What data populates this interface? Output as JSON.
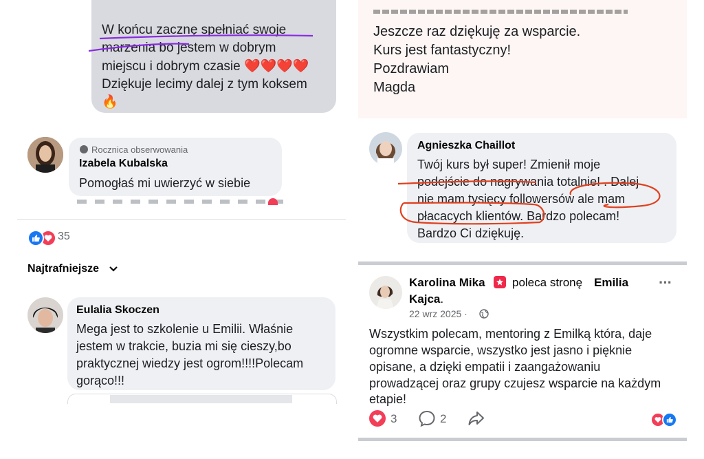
{
  "panel_top_left": {
    "message_lines": [
      "W końcu zacznę spełniać swoje",
      "marzenia bo jestem w dobrym",
      "miejscu i dobrym czasie ❤️❤️❤️❤️",
      "Dziękuje lecimy dalej z tym koksem",
      "🔥"
    ],
    "comment": {
      "badge": "Rocznica obserwowania",
      "author": "Izabela Kubalska",
      "text": "Pomogłaś mi uwierzyć w siebie"
    },
    "reactions_count": "35",
    "sort_label": "Najtrafniejsze",
    "comment2": {
      "author": "Eulalia Skoczen",
      "lines": [
        "Mega jest to szkolenie u Emilii. Właśnie",
        "jestem w trakcie, buzia mi się cieszy,bo",
        "praktycznej wiedzy jest ogrom!!!!Polecam",
        "gorąco!!!"
      ]
    }
  },
  "panel_top_right": {
    "message_lines": [
      "Jeszcze raz dziękuję za wsparcie.",
      " Kurs jest fantastyczny!",
      "Pozdrawiam",
      "Magda"
    ],
    "comment": {
      "author": "Agnieszka Chaillot",
      "lines": [
        "Twój kurs był super! Zmienił moje",
        "podejście do nagrywania totalnie! . Dalej",
        "nie mam tysięcy followersów ale mam",
        "płacacych klientów. Bardzo polecam!",
        "Bardzo Ci dziękuję."
      ]
    }
  },
  "panel_bottom_right": {
    "author": "Karolina Mika",
    "recommends_text": "poleca stronę",
    "page_name": "Emilia",
    "page_name_cont": "Kajca",
    "date": "22 wrz 2025 ·",
    "more_label": "···",
    "body_lines": [
      "Wszystkim polecam, mentoring z Emilką która, daje",
      "ogromne wsparcie, wszystko jest jasno i pięknie",
      "opisane, a dzięki empatii i zaangażowaniu",
      "prowadzącej oraz grupy czujesz wsparcie na każdym",
      "etapie!"
    ],
    "likes_count": "3",
    "comments_count": "2"
  },
  "colors": {
    "messenger_grey": "#d8dadf",
    "comment_bubble": "#eef0f3",
    "heart_red": "#f33e58",
    "like_blue": "#1877f2",
    "underline_purple": "#8a2be2",
    "underline_red": "#e0401f"
  }
}
